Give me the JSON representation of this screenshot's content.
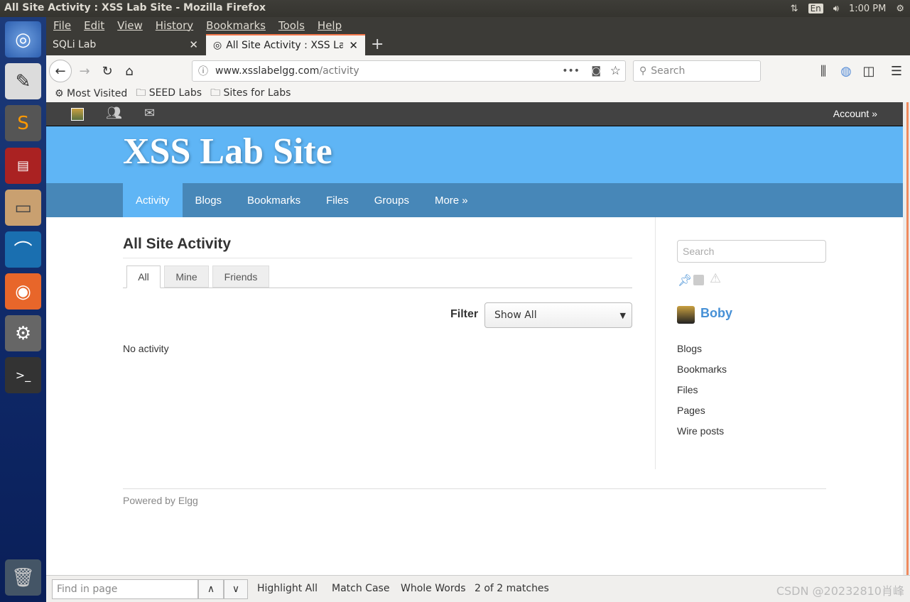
{
  "os": {
    "window_title": "All Site Activity : XSS Lab Site - Mozilla Firefox",
    "tray": {
      "lang": "En",
      "time": "1:00 PM"
    },
    "launcher": [
      "dash-icon",
      "text-editor-icon",
      "sublime-icon",
      "terminal-red-icon",
      "files-icon",
      "wireshark-icon",
      "firefox-icon",
      "settings-icon",
      "terminal-icon",
      "trash-icon"
    ]
  },
  "menu": [
    "File",
    "Edit",
    "View",
    "History",
    "Bookmarks",
    "Tools",
    "Help"
  ],
  "tabs": [
    {
      "label": "SQLi Lab"
    },
    {
      "label": "All Site Activity : XSS Lab Site"
    }
  ],
  "url": {
    "host": "www.xsslabelgg.com",
    "path": "/activity"
  },
  "search_placeholder": "Search",
  "bookmarks": [
    "Most Visited",
    "SEED Labs",
    "Sites for Labs"
  ],
  "site": {
    "account": "Account »",
    "title": "XSS Lab Site",
    "nav": [
      "Activity",
      "Blogs",
      "Bookmarks",
      "Files",
      "Groups",
      "More »"
    ],
    "active_nav": "Activity",
    "heading": "All Site Activity",
    "subtabs": [
      "All",
      "Mine",
      "Friends"
    ],
    "filter_label": "Filter",
    "filter_value": "Show All",
    "empty": "No activity",
    "sidebar": {
      "search_placeholder": "Search",
      "user": "Boby",
      "links": [
        "Blogs",
        "Bookmarks",
        "Files",
        "Pages",
        "Wire posts"
      ]
    },
    "footer": "Powered by Elgg",
    "accent": "#5fb5f5",
    "nav_color": "#4787b8"
  },
  "findbar": {
    "placeholder": "Find in page",
    "highlight": "Highlight All",
    "match_case": "Match Case",
    "whole_words": "Whole Words",
    "status": "2 of 2 matches"
  },
  "watermark": "CSDN @20232810肖峰"
}
